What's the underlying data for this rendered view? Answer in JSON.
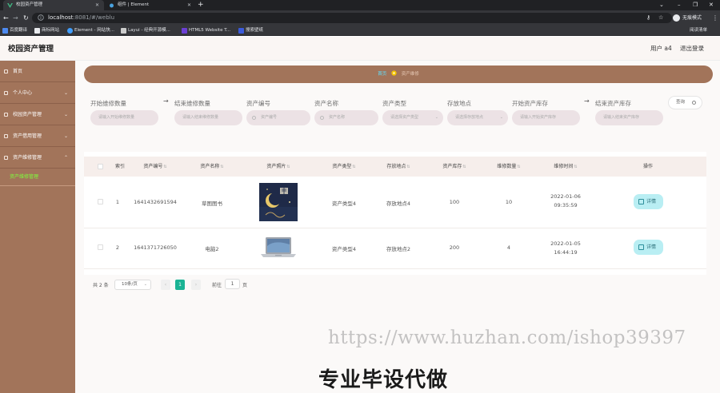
{
  "browser": {
    "tabs": [
      {
        "title": "校园资产管理",
        "active": true
      },
      {
        "title": "组件 | Element",
        "active": false
      }
    ],
    "url_host": "localhost",
    "url_rest": ":8081/#/weblu",
    "profile_label": "无痕模式",
    "bookmarks": [
      "百度翻译",
      "商标网站",
      "Element - 网站快...",
      "Layui - 经典开源模...",
      "HTML5 Website T...",
      "搜索壁纸"
    ],
    "bookmarks_right": "阅读清单"
  },
  "header": {
    "title": "校园资产管理",
    "user": "用户 a4",
    "logout": "退出登录"
  },
  "sidebar": {
    "items": [
      {
        "label": "首页"
      },
      {
        "label": "个人中心"
      },
      {
        "label": "校园资产管理"
      },
      {
        "label": "资产借用管理"
      },
      {
        "label": "资产维修管理"
      }
    ],
    "active_sub": "资产维修管理"
  },
  "breadcrumb": {
    "home": "首页",
    "current": "资产维修"
  },
  "filters": {
    "labels": [
      "开始维修数量",
      "结束维修数量",
      "资产编号",
      "资产名称",
      "资产类型",
      "存放地点",
      "开始资产库存",
      "结束资产库存"
    ],
    "placeholders": [
      "请输入开始维修数量",
      "请输入结束维修数量",
      "资产编号",
      "资产名称",
      "请选择资产类型",
      "请选择存放地点",
      "请输入开始资产库存",
      "请输入结束资产库存"
    ],
    "search_label": "查询"
  },
  "table": {
    "columns": [
      "索引",
      "资产编号",
      "资产名称",
      "资产照片",
      "资产类型",
      "存放地点",
      "资产库存",
      "维修数量",
      "维修时间",
      "操作"
    ],
    "rows": [
      {
        "index": "1",
        "code": "1641432691594",
        "name": "草图图书",
        "image": "book-cover",
        "type": "资产类型4",
        "location": "存放地点4",
        "stock": "100",
        "repair_qty": "10",
        "repair_time": "2022-01-06 09:35:59",
        "action": "详情"
      },
      {
        "index": "2",
        "code": "1641371726050",
        "name": "电脑2",
        "image": "laptop",
        "type": "资产类型4",
        "location": "存放地点2",
        "stock": "200",
        "repair_qty": "4",
        "repair_time": "2022-01-05 16:44:19",
        "action": "详情"
      }
    ]
  },
  "pagination": {
    "total": "共 2 条",
    "page_size": "10条/页",
    "prev": "‹",
    "current_page": "1",
    "next": "›",
    "goto_label": "前往",
    "goto_value": "1",
    "page_suffix": "页"
  },
  "overlay": {
    "watermark": "https://www.huzhan.com/ishop39397",
    "promo": "专业毕设代做"
  }
}
